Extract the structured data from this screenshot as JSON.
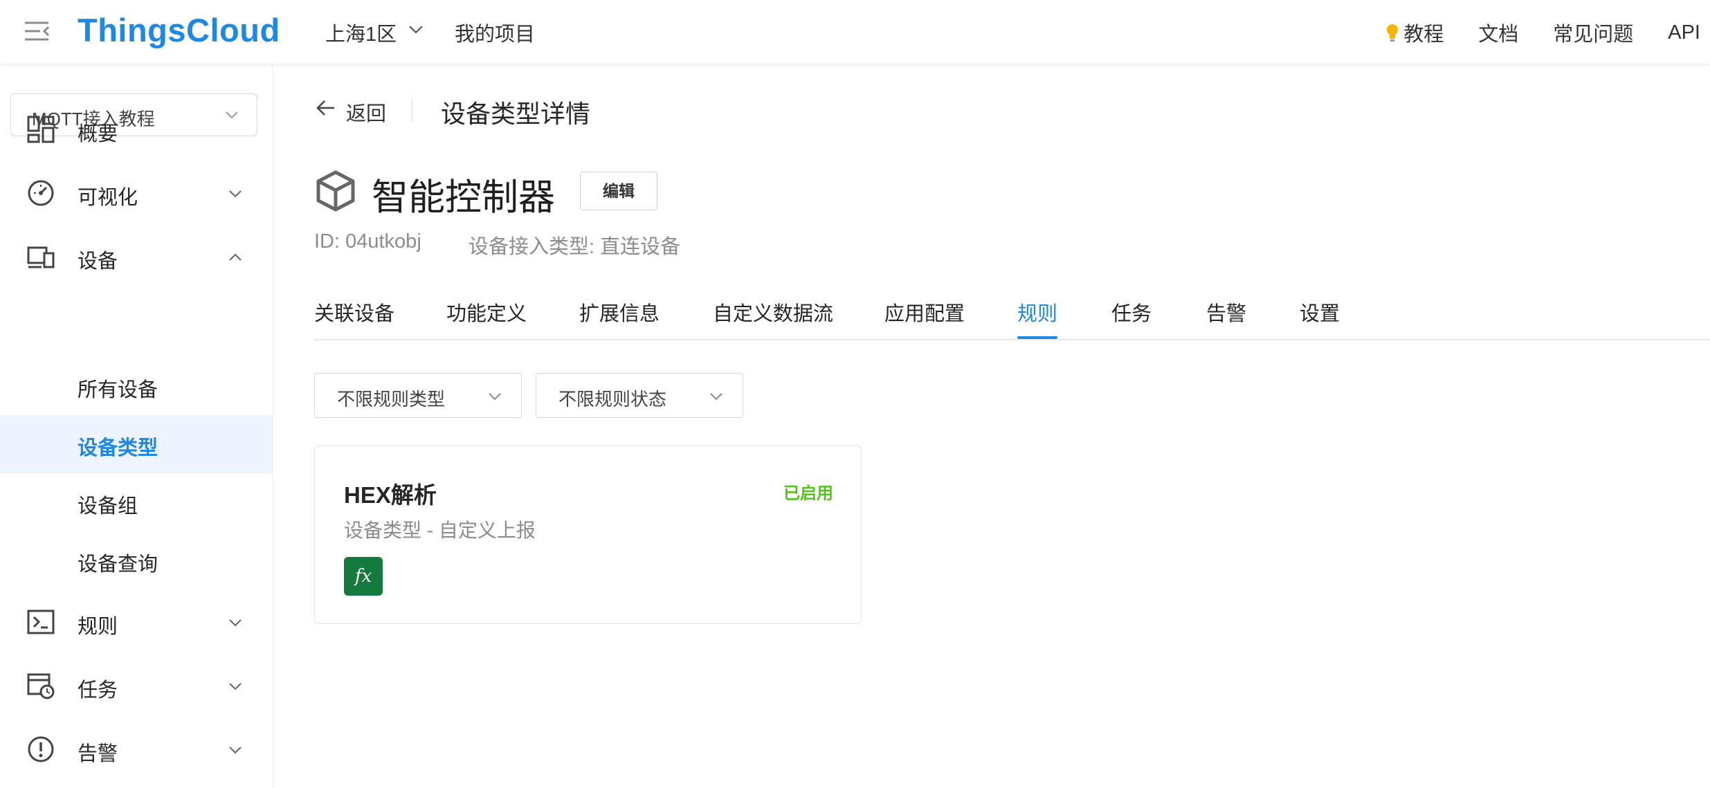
{
  "header": {
    "brand": "ThingsCloud",
    "region": "上海1区",
    "projects": "我的项目",
    "links": [
      "教程",
      "文档",
      "常见问题",
      "API"
    ]
  },
  "sidebar": {
    "project_select": "MQTT接入教程",
    "items": [
      {
        "label": "概要",
        "icon": "dashboard-icon"
      },
      {
        "label": "可视化",
        "icon": "gauge-icon"
      },
      {
        "label": "设备",
        "icon": "devices-icon"
      },
      {
        "label": "规则",
        "icon": "terminal-icon"
      },
      {
        "label": "任务",
        "icon": "task-schedule-icon"
      },
      {
        "label": "告警",
        "icon": "alert-icon"
      }
    ],
    "device_sub": [
      "所有设备",
      "设备类型",
      "设备组",
      "设备查询"
    ]
  },
  "main": {
    "back_label": "返回",
    "page_title": "设备类型详情",
    "device_name": "智能控制器",
    "edit_label": "编辑",
    "id_text": "ID: 04utkobj",
    "access_type_text": "设备接入类型: 直连设备",
    "tabs": [
      "关联设备",
      "功能定义",
      "扩展信息",
      "自定义数据流",
      "应用配置",
      "规则",
      "任务",
      "告警",
      "设置"
    ],
    "active_tab": "规则",
    "filters": {
      "rule_type": "不限规则类型",
      "rule_status": "不限规则状态"
    },
    "rule_card": {
      "name": "HEX解析",
      "status": "已启用",
      "description": "设备类型 - 自定义上报",
      "badge": "fx"
    }
  },
  "colors": {
    "accent": "#1e88e5",
    "active_bg": "#edf4ff",
    "enabled": "#52c41a",
    "fx_badge": "#157a3d"
  }
}
